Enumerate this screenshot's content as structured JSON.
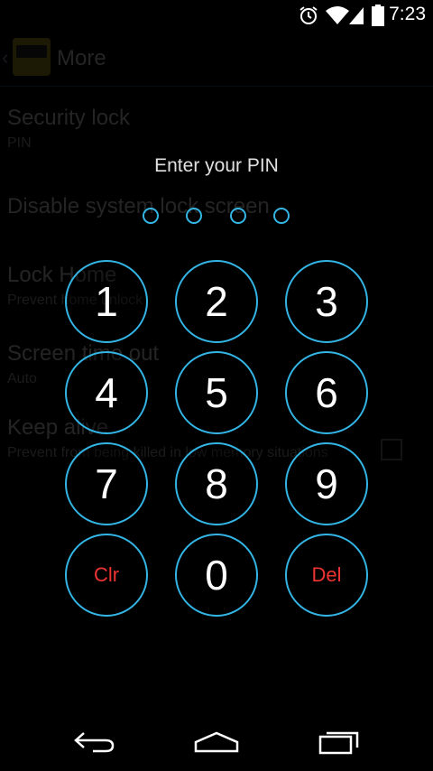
{
  "status_bar": {
    "time": "7:23",
    "icons": [
      "alarm-icon",
      "wifi-icon",
      "cell-signal-icon",
      "battery-icon"
    ]
  },
  "background_screen": {
    "action_bar": {
      "title": "More"
    },
    "preferences": [
      {
        "title": "Security lock",
        "summary": "PIN"
      },
      {
        "title": "Disable system lock screen",
        "summary": ""
      },
      {
        "title": "Lock Home",
        "summary": "Prevent home unlock"
      },
      {
        "title": "Screen time out",
        "summary": "Auto"
      },
      {
        "title": "Keep alive",
        "summary": "Prevent from being killed in low memory situations"
      }
    ]
  },
  "pin_dialog": {
    "prompt": "Enter your PIN",
    "entered_digits": 0,
    "pin_length": 4,
    "keys": [
      "1",
      "2",
      "3",
      "4",
      "5",
      "6",
      "7",
      "8",
      "9",
      "Clr",
      "0",
      "Del"
    ]
  },
  "colors": {
    "accent": "#33b5e5",
    "key_action_text": "#ee3333",
    "background": "#000000"
  },
  "nav_bar": {
    "icons": [
      "back-icon",
      "home-icon",
      "recent-apps-icon"
    ]
  }
}
